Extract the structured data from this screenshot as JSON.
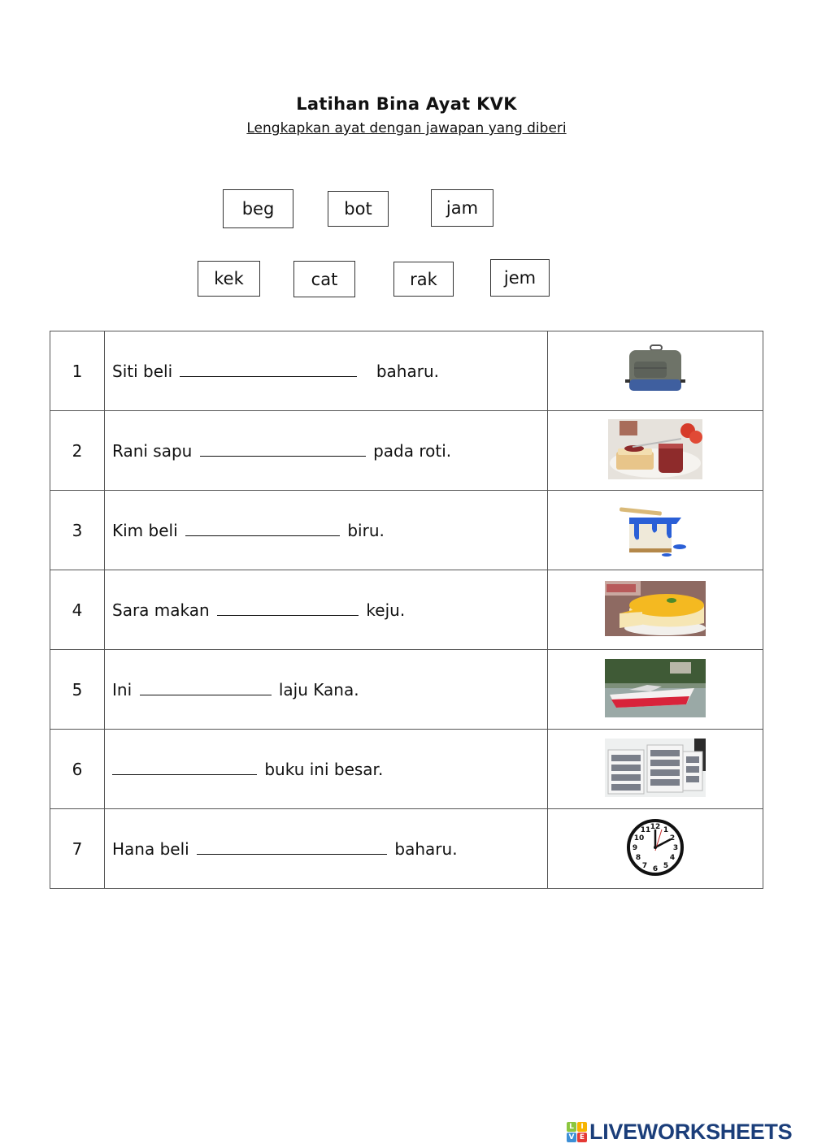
{
  "header": {
    "title": "Latihan Bina Ayat KVK",
    "subtitle": "Lengkapkan ayat dengan jawapan yang diberi"
  },
  "word_bank": [
    "beg",
    "bot",
    "jam",
    "kek",
    "cat",
    "rak",
    "jem"
  ],
  "rows": [
    {
      "num": "1",
      "before": "Siti  beli",
      "after": "baharu.",
      "image": "backpack-image"
    },
    {
      "num": "2",
      "before": "Rani sapu",
      "after": "pada roti.",
      "image": "jam-on-bread-image"
    },
    {
      "num": "3",
      "before": "Kim beli",
      "after": "biru.",
      "image": "blue-paint-can-image"
    },
    {
      "num": "4",
      "before": "Sara makan",
      "after": "keju.",
      "image": "cheesecake-image"
    },
    {
      "num": "5",
      "before": "Ini",
      "after": "laju Kana.",
      "image": "speedboat-image"
    },
    {
      "num": "6",
      "before": "",
      "after": "buku ini besar.",
      "image": "bookshelf-image"
    },
    {
      "num": "7",
      "before": "Hana beli",
      "after": "baharu.",
      "image": "wall-clock-image"
    }
  ],
  "answers": [
    "",
    "",
    "",
    "",
    "",
    "",
    ""
  ],
  "footer": {
    "logo_letters": [
      "L",
      "I",
      "V",
      "E"
    ],
    "logo_colors": [
      "#8cc63f",
      "#f7b500",
      "#3d8fd6",
      "#e53935"
    ],
    "logo_text": "LIVEWORKSHEETS",
    "logo_color": "#1b3e7a"
  }
}
